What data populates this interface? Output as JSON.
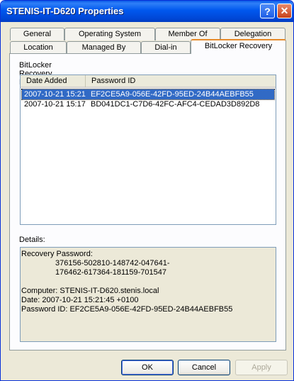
{
  "window": {
    "title": "STENIS-IT-D620 Properties"
  },
  "titlebar_buttons": {
    "help": "?",
    "close": "✕"
  },
  "tabs": {
    "row1": [
      "General",
      "Operating System",
      "Member Of",
      "Delegation"
    ],
    "row2": [
      "Location",
      "Managed By",
      "Dial-in",
      "BitLocker Recovery"
    ],
    "selected": "BitLocker Recovery"
  },
  "passwords_label": "BitLocker Recovery Passwords:",
  "list": {
    "columns": [
      "Date Added",
      "Password ID"
    ],
    "rows": [
      {
        "date": "2007-10-21 15:21",
        "id": "EF2CE5A9-056E-42FD-95ED-24B44AEBFB55",
        "selected": true
      },
      {
        "date": "2007-10-21 15:17",
        "id": "BD041DC1-C7D6-42FC-AFC4-CEDAD3D892D8",
        "selected": false
      }
    ]
  },
  "details": {
    "label": "Details:",
    "recovery_label": "Recovery Password:",
    "recovery_line1": "376156-502810-148742-047641-",
    "recovery_line2": "176462-617364-181159-701547",
    "computer": "Computer: STENIS-IT-D620.stenis.local",
    "date": "Date: 2007-10-21 15:21:45 +0100",
    "password_id": "Password ID: EF2CE5A9-056E-42FD-95ED-24B44AEBFB55"
  },
  "buttons": {
    "ok": "OK",
    "cancel": "Cancel",
    "apply": "Apply"
  }
}
